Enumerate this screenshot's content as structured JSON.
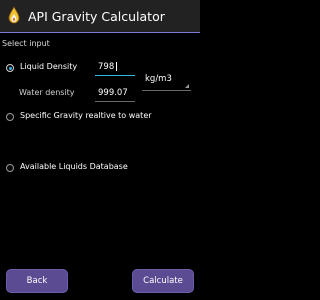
{
  "app": {
    "title": "API Gravity Calculator",
    "icon": "flame-drop-icon"
  },
  "form": {
    "section_header": "Select input",
    "options": [
      {
        "label": "Liquid Density",
        "selected": true
      },
      {
        "label": "Specific Gravity realtive to water",
        "selected": false
      },
      {
        "label": "Available Liquids Database",
        "selected": false
      }
    ],
    "liquid_density_value": "798",
    "unit_selected": "kg/m3",
    "water_density_label": "Water density",
    "water_density_value": "999.07"
  },
  "buttons": {
    "back": "Back",
    "calculate": "Calculate"
  },
  "colors": {
    "accent": "#33b5e5",
    "button": "#5b4b92",
    "action_bar": "#222222"
  }
}
